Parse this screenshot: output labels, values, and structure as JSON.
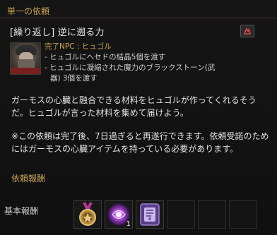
{
  "header": {
    "title": "単一の依頼"
  },
  "quest": {
    "title": "[繰り返し] 逆に遡る力",
    "track_icon": "quest-track-icon"
  },
  "npc": {
    "portrait_icon": "npc-portrait",
    "complete_npc": "完了NPC : ヒュゴル",
    "objectives": [
      "- ヒュゴルにヘセドの結晶5個を渡す",
      "- ヒュゴルに凝縮された魔力のブラックストーン(武",
      "器) 3個を渡す"
    ]
  },
  "description": "ガーモスの心臓と融合できる材料をヒュゴルが作ってくれるそうだ。ヒュゴルが言った材料を集めて届けよう。",
  "note": "※この依頼は完了後、7日過ぎると再遂行できます。依頼受諾のためにはガーモスの心臓アイテムを持っている必要があります。",
  "rewards": {
    "heading": "依頼報酬",
    "base_label": "基本報酬",
    "items": [
      {
        "icon": "medal-icon",
        "count": ""
      },
      {
        "icon": "black-spirit-orb-icon",
        "count": "1"
      },
      {
        "icon": "scroll-icon",
        "count": ""
      },
      {
        "icon": "",
        "count": ""
      },
      {
        "icon": "",
        "count": ""
      },
      {
        "icon": "",
        "count": ""
      }
    ]
  },
  "colors": {
    "accent": "#c8a257",
    "background": "#111111",
    "text": "#e3e3e3"
  }
}
